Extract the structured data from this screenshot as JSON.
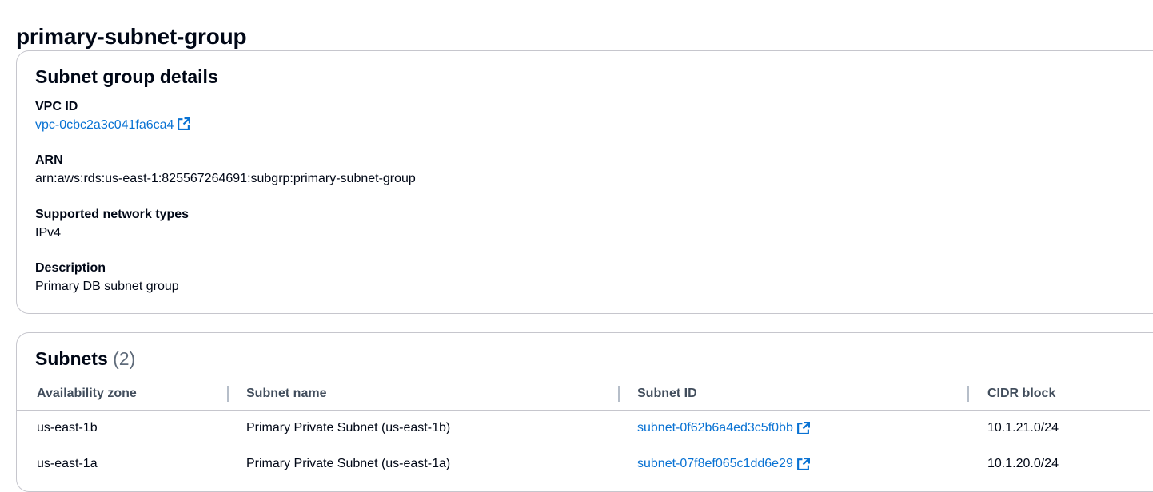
{
  "page": {
    "title": "primary-subnet-group"
  },
  "details": {
    "title": "Subnet group details",
    "vpc": {
      "label": "VPC ID",
      "value": "vpc-0cbc2a3c041fa6ca4",
      "icon": "external-link-icon"
    },
    "arn": {
      "label": "ARN",
      "value": "arn:aws:rds:us-east-1:825567264691:subgrp:primary-subnet-group"
    },
    "network_types": {
      "label": "Supported network types",
      "value": "IPv4"
    },
    "description": {
      "label": "Description",
      "value": "Primary DB subnet group"
    }
  },
  "subnets": {
    "title": "Subnets",
    "count": "(2)",
    "columns": [
      "Availability zone",
      "Subnet name",
      "Subnet ID",
      "CIDR block"
    ],
    "rows": [
      {
        "az": "us-east-1b",
        "name": "Primary Private Subnet (us-east-1b)",
        "id": "subnet-0f62b6a4ed3c5f0bb",
        "cidr": "10.1.21.0/24"
      },
      {
        "az": "us-east-1a",
        "name": "Primary Private Subnet (us-east-1a)",
        "id": "subnet-07f8ef065c1dd6e29",
        "cidr": "10.1.20.0/24"
      }
    ]
  },
  "colors": {
    "link": "#0972d3",
    "text": "#000716",
    "border": "#c6c6cd",
    "header_text": "#414d5c"
  }
}
